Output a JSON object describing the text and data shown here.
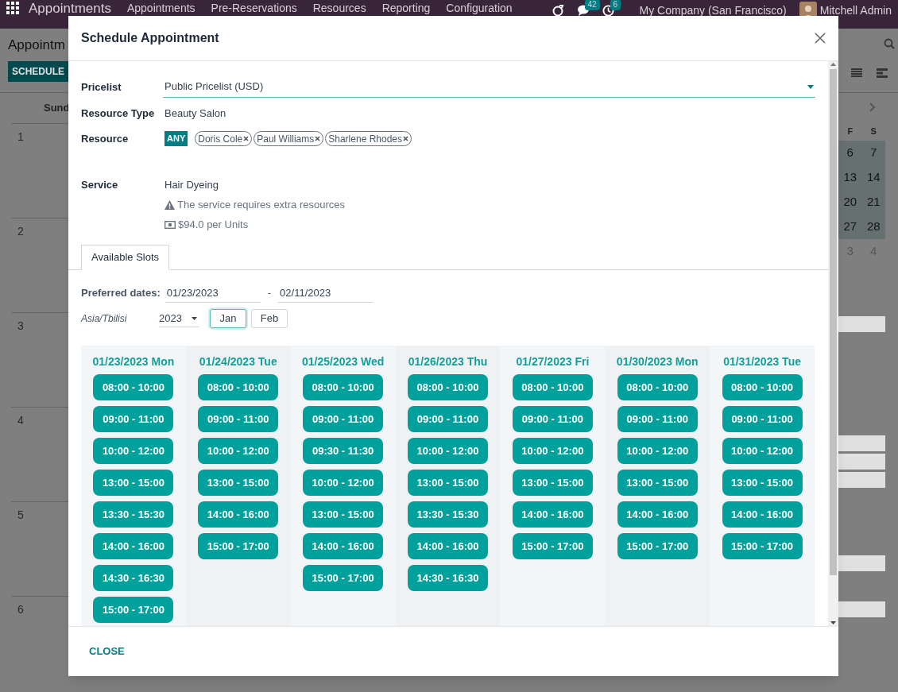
{
  "navbar": {
    "app_title": "Appointments",
    "menus": [
      "Appointments",
      "Pre-Reservations",
      "Resources",
      "Reporting",
      "Configuration"
    ],
    "counters": [
      {
        "kind": "chat",
        "count": "42"
      },
      {
        "kind": "activity",
        "count": "6"
      }
    ],
    "company": "My Company (San Francisco)",
    "user": "Mitchell Admin"
  },
  "control_panel": {
    "title": "Appointm",
    "button": "SCHEDULE"
  },
  "calendar": {
    "day_header": "Sund",
    "week_numbers": [
      "1",
      "2",
      "3",
      "4",
      "5",
      "6"
    ]
  },
  "mini_calendar": {
    "day_headers": [
      "F",
      "S"
    ],
    "weeks": [
      {
        "days": [
          "6",
          "7"
        ],
        "in_month": true
      },
      {
        "days": [
          "13",
          "14"
        ],
        "in_month": true
      },
      {
        "days": [
          "20",
          "21"
        ],
        "in_month": true
      },
      {
        "days": [
          "27",
          "28"
        ],
        "in_month": true
      },
      {
        "days": [
          "3",
          "4"
        ],
        "in_month": false
      }
    ]
  },
  "dialog": {
    "title": "Schedule Appointment",
    "fields": [
      {
        "label": "Pricelist",
        "kind": "select",
        "value": "Public Pricelist (USD)"
      },
      {
        "label": "Resource Type",
        "kind": "text",
        "value": "Beauty Salon"
      },
      {
        "label": "Resource",
        "kind": "tags",
        "badge": "ANY",
        "tags": [
          "Doris Cole",
          "Paul Williams",
          "Sharlene Rhodes"
        ]
      },
      {
        "label": "Service",
        "kind": "service",
        "value": "Hair Dyeing",
        "notes": [
          {
            "kind": "warning",
            "text": "The service requires extra resources"
          },
          {
            "kind": "price",
            "text": "$94.0 per Units"
          }
        ]
      }
    ],
    "tabs": [
      {
        "label": "Available Slots",
        "selected": true
      }
    ],
    "preferred_dates": {
      "label": "Preferred dates:",
      "from": "01/23/2023",
      "to": "02/11/2023",
      "separator": "-"
    },
    "timezone": "Asia/Tbilisi",
    "year": "2023",
    "months": [
      {
        "label": "Jan",
        "selected": true
      },
      {
        "label": "Feb",
        "selected": false
      }
    ],
    "days": [
      {
        "heading": "01/23/2023 Mon",
        "slots": [
          "08:00 - 10:00",
          "09:00 - 11:00",
          "10:00 - 12:00",
          "13:00 - 15:00",
          "13:30 - 15:30",
          "14:00 - 16:00",
          "14:30 - 16:30",
          "15:00 - 17:00"
        ]
      },
      {
        "heading": "01/24/2023 Tue",
        "slots": [
          "08:00 - 10:00",
          "09:00 - 11:00",
          "10:00 - 12:00",
          "13:00 - 15:00",
          "14:00 - 16:00",
          "15:00 - 17:00"
        ]
      },
      {
        "heading": "01/25/2023 Wed",
        "slots": [
          "08:00 - 10:00",
          "09:00 - 11:00",
          "09:30 - 11:30",
          "10:00 - 12:00",
          "13:00 - 15:00",
          "14:00 - 16:00",
          "15:00 - 17:00"
        ]
      },
      {
        "heading": "01/26/2023 Thu",
        "slots": [
          "08:00 - 10:00",
          "09:00 - 11:00",
          "10:00 - 12:00",
          "13:00 - 15:00",
          "13:30 - 15:30",
          "14:00 - 16:00",
          "14:30 - 16:30"
        ]
      },
      {
        "heading": "01/27/2023 Fri",
        "slots": [
          "08:00 - 10:00",
          "09:00 - 11:00",
          "10:00 - 12:00",
          "13:00 - 15:00",
          "14:00 - 16:00",
          "15:00 - 17:00"
        ]
      },
      {
        "heading": "01/30/2023 Mon",
        "slots": [
          "08:00 - 10:00",
          "09:00 - 11:00",
          "10:00 - 12:00",
          "13:00 - 15:00",
          "14:00 - 16:00",
          "15:00 - 17:00"
        ]
      },
      {
        "heading": "01/31/2023 Tue",
        "slots": [
          "08:00 - 10:00",
          "09:00 - 11:00",
          "10:00 - 12:00",
          "13:00 - 15:00",
          "14:00 - 16:00",
          "15:00 - 17:00"
        ]
      }
    ],
    "footer_button": "CLOSE"
  }
}
